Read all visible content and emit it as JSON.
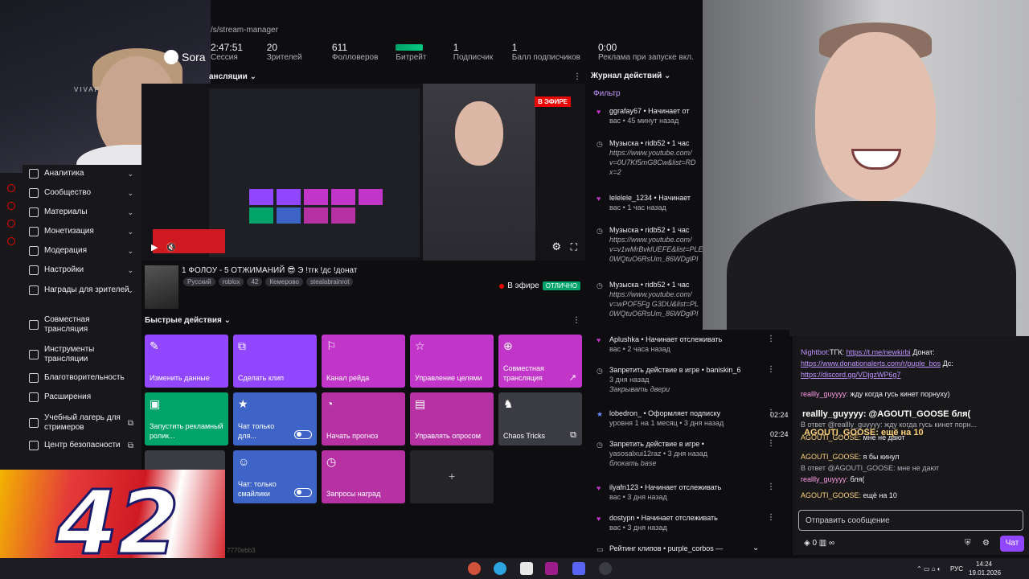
{
  "url": "/s/stream-manager",
  "stats": [
    {
      "value": "2:47:51",
      "label": "Сессия"
    },
    {
      "value": "20",
      "label": "Зрителей"
    },
    {
      "value": "611",
      "label": "Фолловеров"
    },
    {
      "value": "",
      "label": "Битрейт"
    },
    {
      "value": "1",
      "label": "Подписчик"
    },
    {
      "value": "1",
      "label": "Балл подписчиков"
    },
    {
      "value": "0:00",
      "label": "Реклама при запуске вкл."
    }
  ],
  "overlay": {
    "sora": "Sora",
    "vivap": "VIVAP"
  },
  "nav": [
    {
      "label": "Аналитика",
      "chev": true
    },
    {
      "label": "Сообщество",
      "chev": true
    },
    {
      "label": "Материалы",
      "chev": true
    },
    {
      "label": "Монетизация",
      "chev": true
    },
    {
      "label": "Модерация",
      "chev": true
    },
    {
      "label": "Настройки",
      "chev": true
    },
    {
      "label": "Награды для зрителей",
      "chev": true
    },
    {
      "label": "Совместная трансляция",
      "chev": false
    },
    {
      "label": "Инструменты трансляции",
      "chev": false
    },
    {
      "label": "Благотворительность",
      "chev": false
    },
    {
      "label": "Расширения",
      "chev": false
    },
    {
      "label": "Учебный лагерь для стримеров",
      "chev": false
    },
    {
      "label": "Центр безопасности",
      "chev": false
    }
  ],
  "preview": {
    "panel_title": "ансляции",
    "live_badge": "В ЭФИРЕ"
  },
  "stream_info": {
    "title": "1 ФОЛОУ - 5 ОТЖИМАНИЙ 😎 Э !тгк !дс !донат",
    "tags": [
      "Русский",
      "roblox",
      "42",
      "Кемерово",
      "stealabrainrot"
    ],
    "on_air": "В эфире",
    "status": "ОТЛИЧНО"
  },
  "quick_actions": {
    "title": "Быстрые действия",
    "items": [
      {
        "label": "Изменить данные",
        "icon": "✎",
        "color": "purple"
      },
      {
        "label": "Сделать клип",
        "icon": "⧉",
        "color": "purple"
      },
      {
        "label": "Канал рейда",
        "icon": "⚐",
        "color": "magenta"
      },
      {
        "label": "Управление целями",
        "icon": "☆",
        "color": "magenta"
      },
      {
        "label": "Совместная трансляция",
        "icon": "⊕",
        "color": "magenta",
        "arrow": "↗"
      },
      {
        "label": "Запустить рекламный ролик...",
        "icon": "▣",
        "color": "green"
      },
      {
        "label": "Чат только для...",
        "icon": "★",
        "color": "blue",
        "toggle": true
      },
      {
        "label": "Начать прогноз",
        "icon": "◔",
        "color": "pink"
      },
      {
        "label": "Управлять опросом",
        "icon": "▤",
        "color": "pink"
      },
      {
        "label": "Chaos Tricks",
        "icon": "♞",
        "color": "gray",
        "arrow": "⧉"
      },
      {
        "label": "",
        "icon": "",
        "color": "gray"
      },
      {
        "label": "Чат: только смайлики",
        "icon": "☺",
        "color": "blue",
        "toggle": true
      },
      {
        "label": "Запросы наград",
        "icon": "◷",
        "color": "pink"
      },
      {
        "label": "",
        "icon": "+",
        "color": "dark"
      }
    ]
  },
  "feed": {
    "title": "Журнал действий",
    "filter": "Фильтр",
    "items": [
      {
        "icon": "♥",
        "kind": "heart",
        "text": "ggrafay67 • Начинает от",
        "meta": "вас • 45 минут назад"
      },
      {
        "icon": "◷",
        "kind": "clock",
        "text": "Музыска • ridb52 • 1 час",
        "meta": "",
        "sub": "https://www.youtube.com/ v=0U7Kf5mG8Cw&list=RD x=2"
      },
      {
        "icon": "♥",
        "kind": "heart",
        "text": "lelelele_1234 • Начинает",
        "meta": "вас • 1 час назад"
      },
      {
        "icon": "◷",
        "kind": "clock",
        "text": "Музыска • ridb52 • 1 час",
        "meta": "",
        "sub": "https://www.youtube.com/ v=v1wMrBvklUEFE&list=PLE 0WQtuO6RsUm_86WDglPI"
      },
      {
        "icon": "◷",
        "kind": "clock",
        "text": "Музыска • ridb52 • 1 час",
        "meta": "",
        "sub": "https://www.youtube.com/ v=wPOF5Fg G3DU&list=PL 0WQtuO6RsUm_86WDglPI"
      },
      {
        "icon": "♥",
        "kind": "heart",
        "text": "Aplushka • Начинает отслеживать",
        "meta": "вас • 2 часа назад"
      },
      {
        "icon": "◷",
        "kind": "clock",
        "text": "Запретить действие в игре • baniskin_6",
        "meta": "3 дня назад",
        "sub": "Закрывать двери"
      },
      {
        "icon": "★",
        "kind": "star",
        "text": "lobedron_ • Оформляет подписку",
        "meta": "уровня 1 на 1 месяц • 3 дня назад"
      },
      {
        "icon": "◷",
        "kind": "clock",
        "text": "Запретить действие в игре •",
        "meta": "yasosalxui12raz • 3 дня назад",
        "sub": "блокать base"
      },
      {
        "icon": "♥",
        "kind": "heart",
        "text": "ilyafn123 • Начинает отслеживать",
        "meta": "вас • 3 дня назад"
      },
      {
        "icon": "♥",
        "kind": "heart",
        "text": "dostypn • Начинает отслеживать",
        "meta": "вас • 3 дня назад"
      },
      {
        "icon": "▭",
        "kind": "clock",
        "text": "Рейтинг клипов • purple_corbos —",
        "meta": ""
      }
    ]
  },
  "chat": {
    "lines": [
      {
        "name": "Nightbot:",
        "text": "ТГК: ",
        "link": "https://t.me/newkirbi",
        "rest": " Донат:"
      },
      {
        "name": "",
        "text": "",
        "link": "https://www.donationalerts.com/r/puple_bos",
        "rest": " Дс:"
      },
      {
        "name": "",
        "text": "",
        "link": "https://discord.gg/VDjgzWP6g7",
        "rest": ""
      },
      {
        "name": "reallly_guyyyy:",
        "text": " жду когда гусь кинет порнуху)",
        "link": "",
        "rest": ""
      },
      {
        "name": "",
        "text": "В ответ @reallly_guyyyy: жду когда гусь кинет порн...",
        "link": "",
        "rest": ""
      },
      {
        "name": "AGOUTI_GOOSE:",
        "text": " мне не дают",
        "link": "",
        "rest": ""
      },
      {
        "name": "AGOUTI_GOOSE:",
        "text": " я бы кинул",
        "link": "",
        "rest": ""
      },
      {
        "name": "",
        "text": "В ответ @AGOUTI_GOOSE: мне не дают",
        "link": "",
        "rest": ""
      },
      {
        "name": "reallly_guyyyy:",
        "text": " бля(",
        "link": "",
        "rest": ""
      },
      {
        "name": "AGOUTI_GOOSE:",
        "text": " ещё на 10",
        "link": "",
        "rest": ""
      }
    ],
    "overlay1": "reallly_guyyyy: @AGOUTI_GOOSE бля(",
    "overlay2": "AGOUTI_GOOSE: ещё на 10",
    "time1": "02:24",
    "time2": "02:24",
    "input_placeholder": "Отправить сообщение",
    "send": "Чат",
    "points": "0",
    "inf": "∞"
  },
  "badge": {
    "number": "42"
  },
  "footer_code": "7770ebb3",
  "taskbar": {
    "lang": "РУС",
    "time": "14:24",
    "date": "19.01.2026"
  }
}
